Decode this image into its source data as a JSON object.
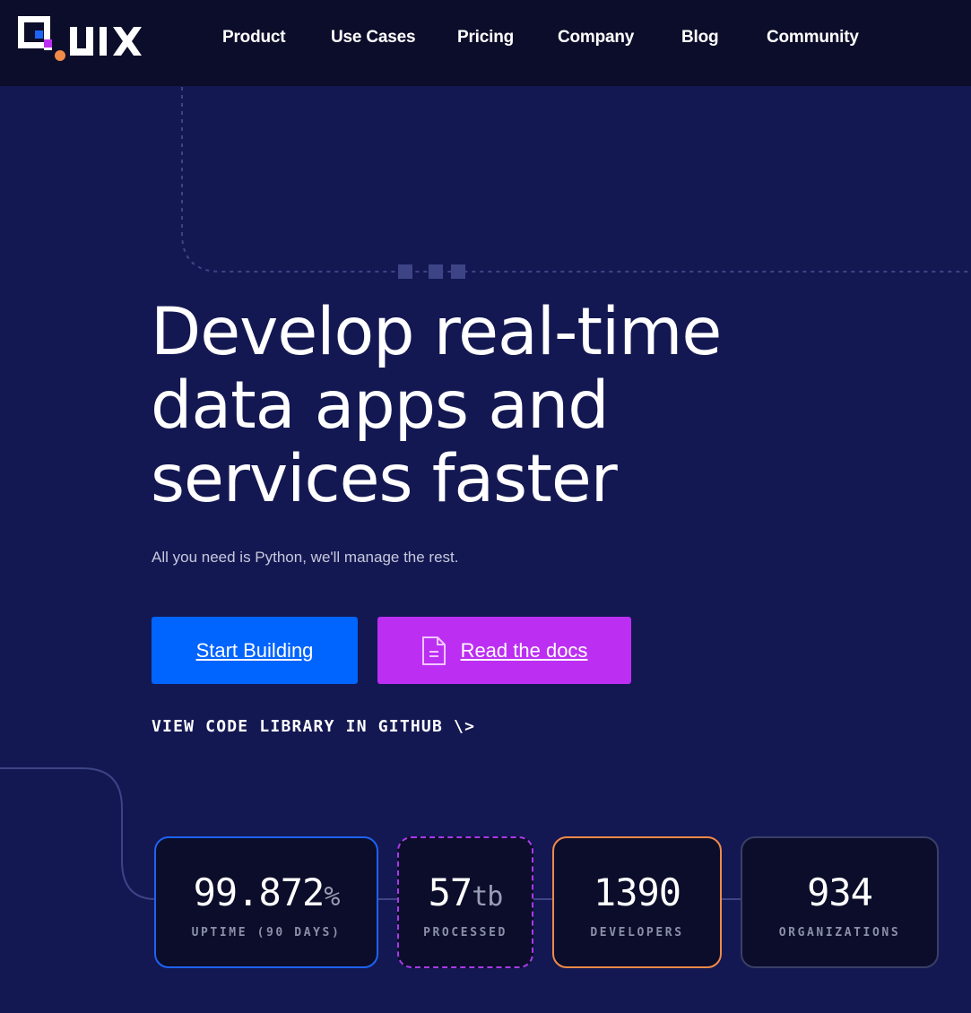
{
  "nav": {
    "logo_text": "Quix",
    "links": [
      "Product",
      "Use Cases",
      "Pricing",
      "Company",
      "Blog",
      "Community"
    ]
  },
  "hero": {
    "title_lines": [
      "Develop real-time",
      "data apps and",
      "services faster"
    ],
    "subtitle": "All you need is Python, we'll manage the rest.",
    "primary_button": "Start Building",
    "secondary_button": "Read the docs",
    "code_link": "VIEW CODE LIBRARY IN GITHUB \\>"
  },
  "stats": [
    {
      "value": "99.872",
      "unit": "%",
      "label": "UPTIME (90 DAYS)"
    },
    {
      "value": "57",
      "unit": "tb",
      "label": "PROCESSED"
    },
    {
      "value": "1390",
      "unit": "",
      "label": "DEVELOPERS"
    },
    {
      "value": "934",
      "unit": "",
      "label": "ORGANIZATIONS"
    }
  ],
  "colors": {
    "background": "#141852",
    "nav_background": "#0b0d2a",
    "primary": "#0064ff",
    "secondary": "#bc2ff2",
    "accent_orange": "#f08a48"
  },
  "icons": {
    "logo": "quix-logo",
    "docs_button": "document-icon"
  }
}
